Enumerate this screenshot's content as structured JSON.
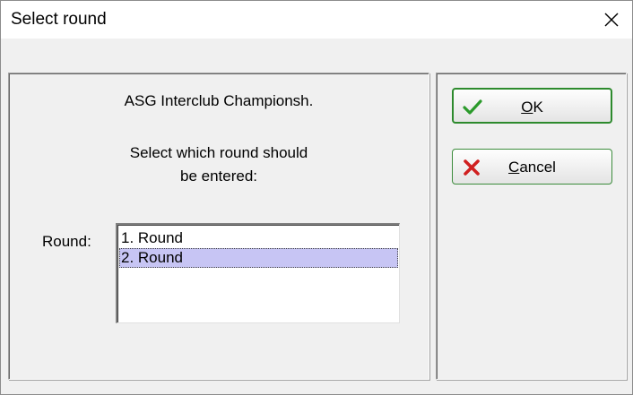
{
  "window": {
    "title": "Select round"
  },
  "dialog": {
    "championship": "ASG Interclub Championsh.",
    "prompt_line1": "Select which round should",
    "prompt_line2": "be entered:",
    "round_label": "Round:",
    "rounds": [
      {
        "label": "1. Round",
        "selected": false
      },
      {
        "label": "2. Round",
        "selected": true
      }
    ]
  },
  "buttons": {
    "ok": {
      "mnemonic": "O",
      "rest": "K"
    },
    "cancel": {
      "mnemonic": "C",
      "rest": "ancel"
    }
  },
  "colors": {
    "selection": "#c7c5f4",
    "ok_check": "#2b9a2b",
    "cancel_x": "#d02020"
  },
  "icons": {
    "close": "close-icon",
    "ok": "checkmark-icon",
    "cancel": "x-icon"
  }
}
